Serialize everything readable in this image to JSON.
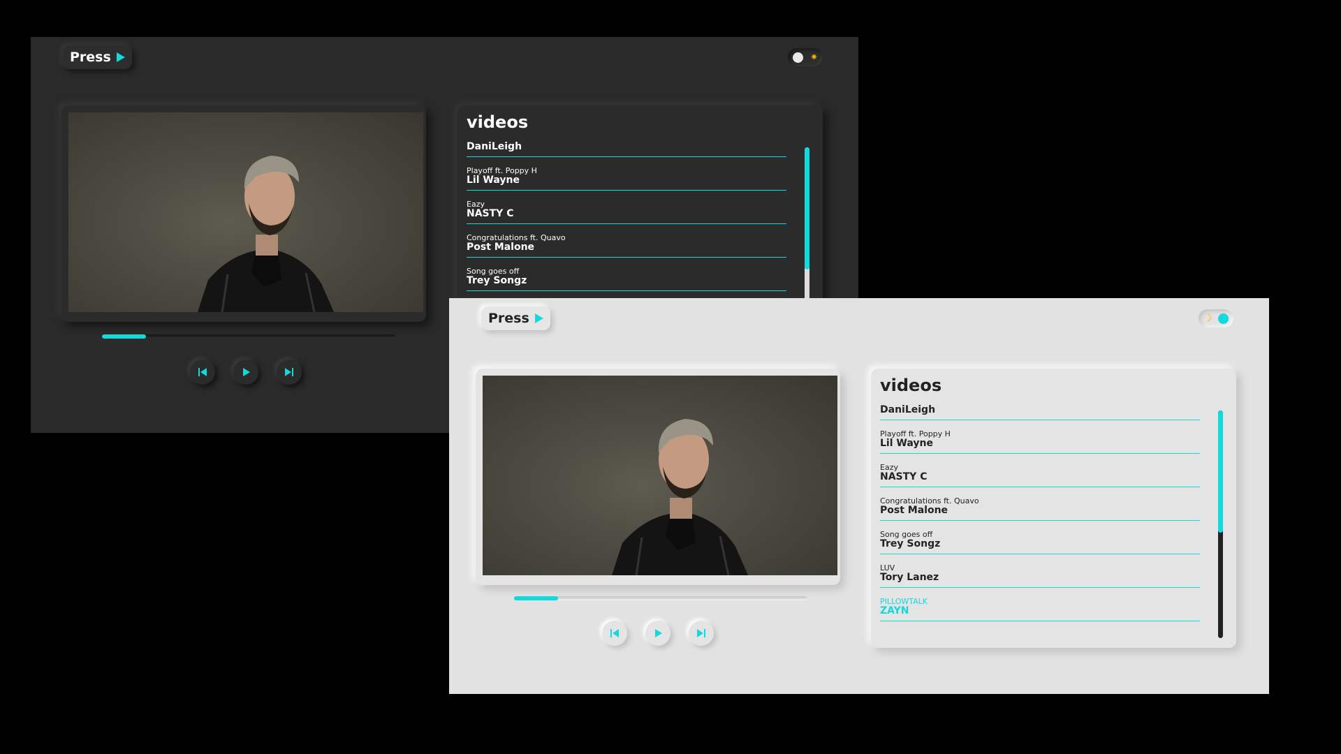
{
  "app": {
    "logo_text": "Press",
    "accent_color": "#13d8dc"
  },
  "dark_theme": {
    "background": "#2a2a2a",
    "theme_toggle": {
      "state": "dark",
      "icon": "sun-icon"
    },
    "progress_fraction": 0.15,
    "playlist_title": "videos",
    "videos": [
      {
        "song": "",
        "artist": "DaniLeigh"
      },
      {
        "song": "Playoff ft. Poppy H",
        "artist": "Lil Wayne"
      },
      {
        "song": "Eazy",
        "artist": "NASTY C"
      },
      {
        "song": "Congratulations ft. Quavo",
        "artist": "Post Malone"
      },
      {
        "song": "Song goes off",
        "artist": "Trey Songz"
      }
    ]
  },
  "light_theme": {
    "background": "#e2e2e2",
    "theme_toggle": {
      "state": "light",
      "icon": "moon-icon"
    },
    "progress_fraction": 0.15,
    "playlist_title": "videos",
    "videos": [
      {
        "song": "",
        "artist": "DaniLeigh"
      },
      {
        "song": "Playoff ft. Poppy H",
        "artist": "Lil Wayne"
      },
      {
        "song": "Eazy",
        "artist": "NASTY C"
      },
      {
        "song": "Congratulations ft. Quavo",
        "artist": "Post Malone"
      },
      {
        "song": "Song goes off",
        "artist": "Trey Songz"
      },
      {
        "song": "LUV",
        "artist": "Tory Lanez"
      },
      {
        "song": "PILLOWTALK",
        "artist": "ZAYN",
        "active": true
      }
    ]
  },
  "controls": {
    "previous": "skip-previous-icon",
    "play": "play-icon",
    "next": "skip-next-icon"
  }
}
